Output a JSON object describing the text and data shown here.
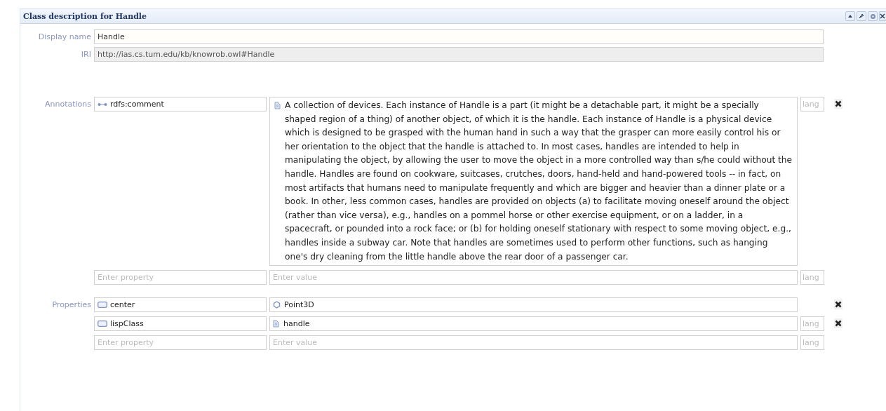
{
  "panel": {
    "title": "Class description for Handle"
  },
  "display_name": {
    "label": "Display name",
    "value": "Handle"
  },
  "iri": {
    "label": "IRI",
    "value": "http://ias.cs.tum.edu/kb/knowrob.owl#Handle"
  },
  "annotations": {
    "label": "Annotations",
    "rows": [
      {
        "property": {
          "text": "rdfs:comment",
          "kind": "annotation"
        },
        "value": {
          "kind": "literal",
          "text": "A collection of devices. Each instance of Handle is a part (it might be a detachable part, it might be a specially shaped region of a thing) of another object, of which it is the handle. Each instance of Handle is a physical device which is designed to be grasped with the human hand in such a way that the grasper can more easily control his or her orientation to the object that the handle is attached to. In most cases, handles are intended to help in manipulating the object, by allowing the user to move the object in a more controlled way than s/he could without the handle. Handles are found on cookware, suitcases, crutches, doors, hand-held and hand-powered tools -- in fact, on most artifacts that humans need to manipulate frequently and which are bigger and heavier than a dinner plate or a book. In other, less common cases, handles are provided on objects (a) to facilitate moving oneself around the object (rather than vice versa), e.g., handles on a pommel horse or other exercise equipment, or on a ladder, in a spacecraft, or pounded into a rock face; or (b) for holding oneself stationary with respect to some moving object, e.g., handles inside a subway car. Note that handles are sometimes used to perform other functions, such as hanging one's dry cleaning from the little handle above the rear door of a passenger car."
        },
        "lang_placeholder": "lang"
      }
    ],
    "new_row": {
      "property_placeholder": "Enter property",
      "value_placeholder": "Enter value",
      "lang_placeholder": "lang"
    }
  },
  "properties": {
    "label": "Properties",
    "rows": [
      {
        "property": {
          "text": "center",
          "kind": "property"
        },
        "value": {
          "text": "Point3D",
          "kind": "individual"
        }
      },
      {
        "property": {
          "text": "lispClass",
          "kind": "property"
        },
        "value": {
          "text": "handle",
          "kind": "literal"
        },
        "lang_placeholder": "lang"
      }
    ],
    "new_row": {
      "property_placeholder": "Enter property",
      "value_placeholder": "Enter value",
      "lang_placeholder": "lang"
    }
  }
}
